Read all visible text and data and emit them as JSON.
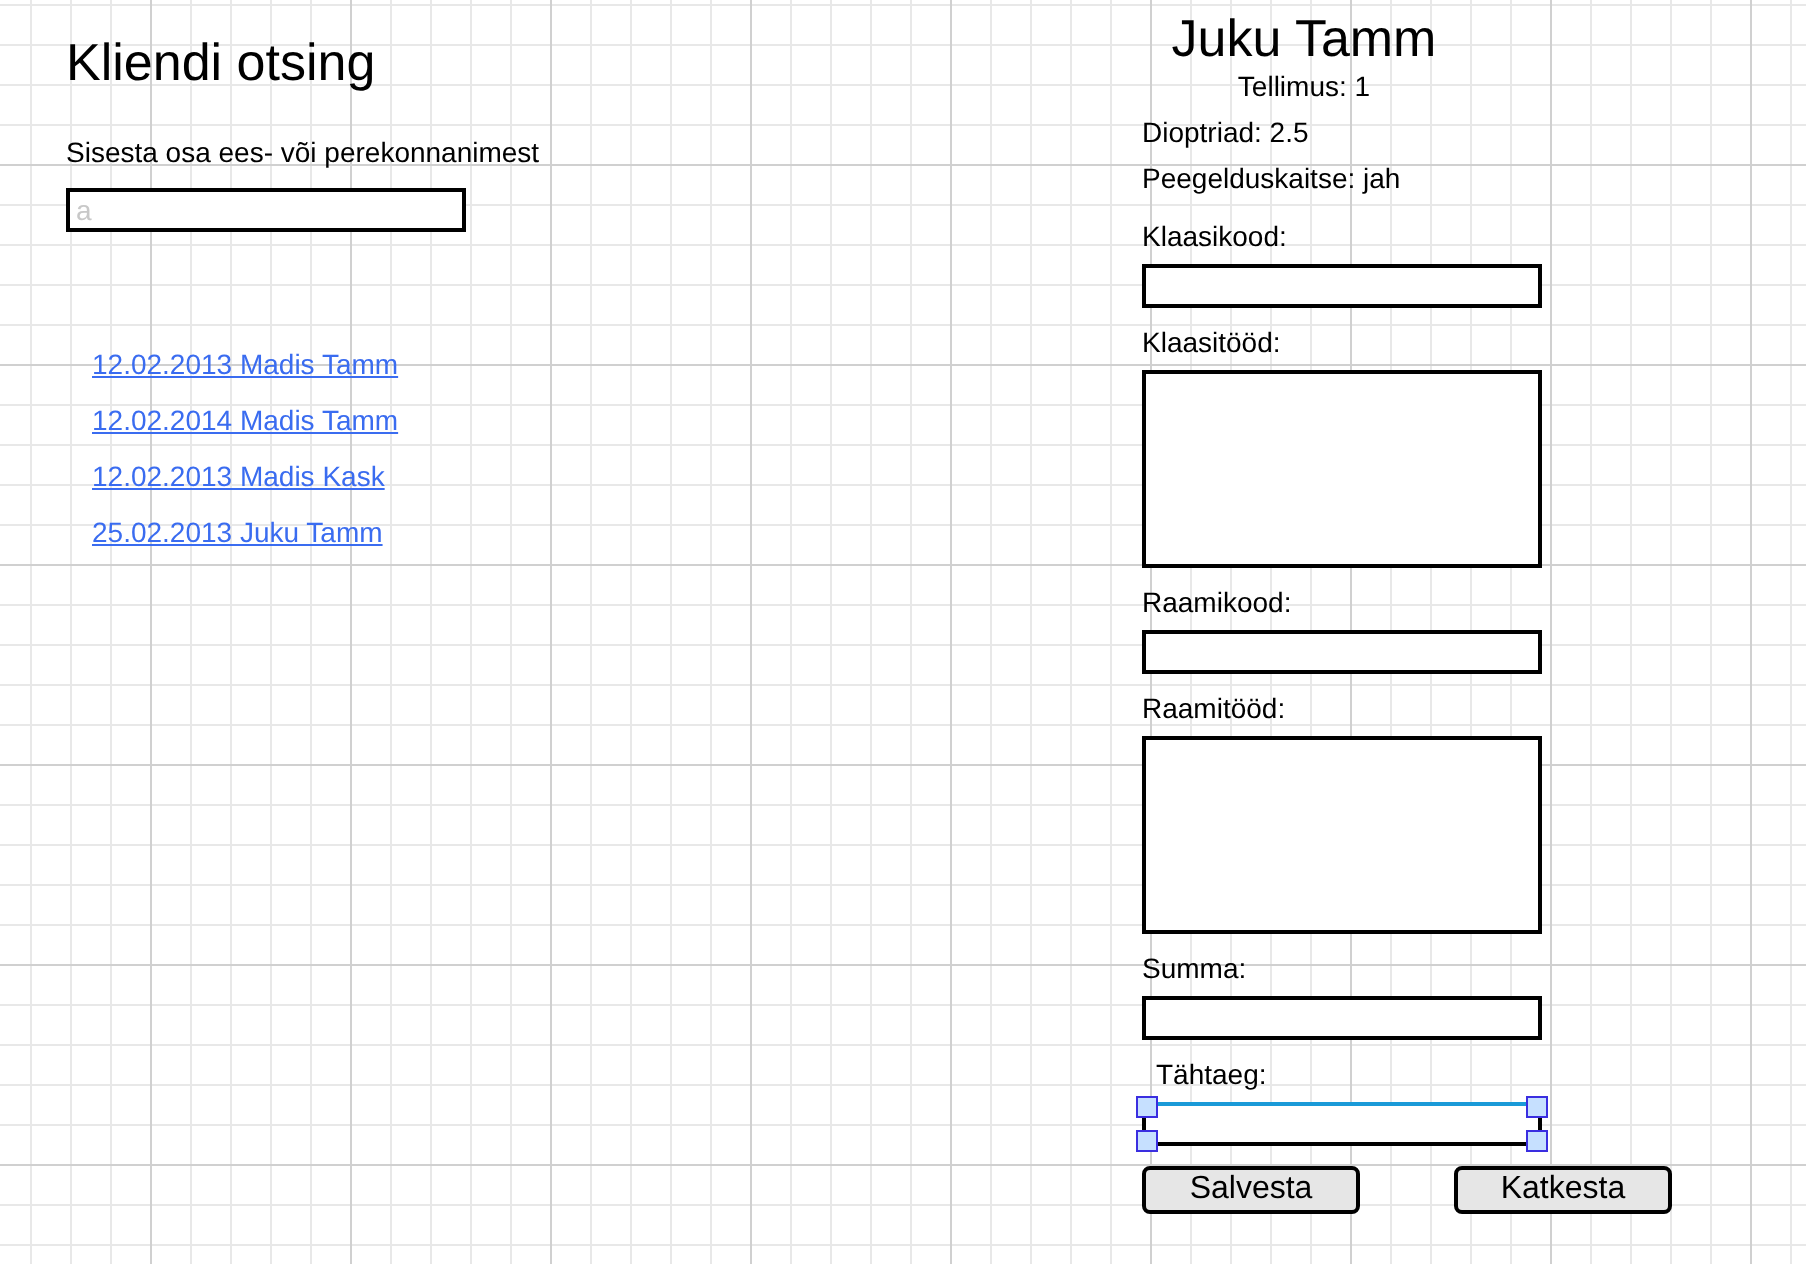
{
  "search_panel": {
    "title": "Kliendi otsing",
    "prompt": "Sisesta osa ees- või perekonnanimest",
    "search": {
      "placeholder": "a"
    },
    "results": [
      {
        "label": "12.02.2013 Madis Tamm"
      },
      {
        "label": "12.02.2014 Madis Tamm"
      },
      {
        "label": "12.02.2013 Madis Kask"
      },
      {
        "label": "25.02.2013 Juku Tamm"
      }
    ]
  },
  "order_panel": {
    "customer": "Juku Tamm",
    "order": "Tellimus: 1",
    "details": [
      "Dioptriad: 2.5",
      "Peegelduskaitse: jah"
    ],
    "fields": [
      {
        "kind": "line",
        "label": "Klaasikood:",
        "selected": false
      },
      {
        "kind": "area",
        "label": "Klaasitööd:",
        "selected": false
      },
      {
        "kind": "line",
        "label": "Raamikood:",
        "selected": false
      },
      {
        "kind": "area",
        "label": "Raamitööd:",
        "selected": false
      },
      {
        "kind": "line",
        "label": "Summa:",
        "selected": false
      },
      {
        "kind": "line",
        "label": "Tähtaeg:",
        "selected": true
      }
    ],
    "buttons": [
      "Salvesta",
      "Katkesta"
    ]
  }
}
